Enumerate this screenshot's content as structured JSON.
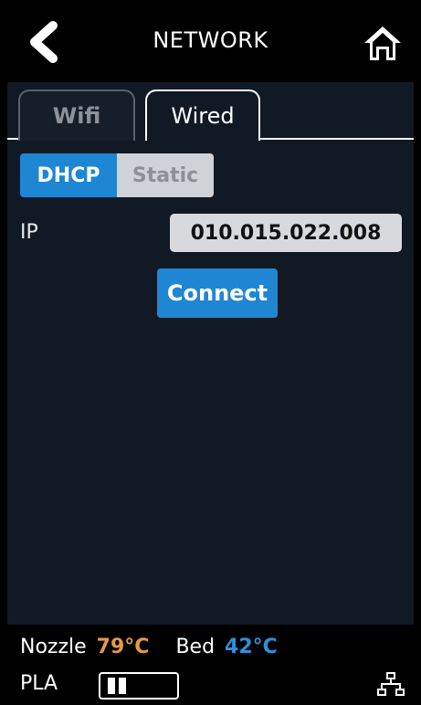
{
  "header": {
    "title": "NETWORK",
    "back_icon": "chevron-left-icon",
    "home_icon": "home-icon"
  },
  "tabs": [
    {
      "label": "Wifi",
      "active": false
    },
    {
      "label": "Wired",
      "active": true
    }
  ],
  "mode_toggle": {
    "options": [
      "DHCP",
      "Static"
    ],
    "selected": "DHCP"
  },
  "ip": {
    "label": "IP",
    "value": "010.015.022.008"
  },
  "connect_label": "Connect",
  "status": {
    "nozzle_label": "Nozzle",
    "nozzle_temp": "79°C",
    "bed_label": "Bed",
    "bed_temp": "42°C",
    "material": "PLA",
    "network_icon": "wired-network-icon"
  },
  "colors": {
    "accent": "#1f86d3",
    "panel": "#111925",
    "nozzle": "#e39a46",
    "bed": "#2f8fda"
  }
}
